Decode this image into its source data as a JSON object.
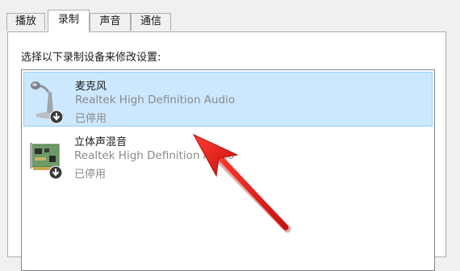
{
  "tabs": [
    {
      "label": "播放",
      "active": false
    },
    {
      "label": "录制",
      "active": true
    },
    {
      "label": "声音",
      "active": false
    },
    {
      "label": "通信",
      "active": false
    }
  ],
  "panel": {
    "instruction": "选择以下录制设备来修改设置:",
    "devices": [
      {
        "name": "麦克风",
        "driver": "Realtek High Definition Audio",
        "status": "已停用",
        "icon": "microphone-icon",
        "badge": "disabled-down-arrow-badge",
        "selected": true
      },
      {
        "name": "立体声混音",
        "driver": "Realtek High Definition Audio",
        "status": "已停用",
        "icon": "sound-card-icon",
        "badge": "disabled-down-arrow-badge",
        "selected": false
      }
    ]
  },
  "colors": {
    "selection_bg": "#cce8ff",
    "selection_border": "#99d1ff",
    "annotation_arrow": "#e8231f",
    "secondary_text": "#8a8a8a"
  }
}
